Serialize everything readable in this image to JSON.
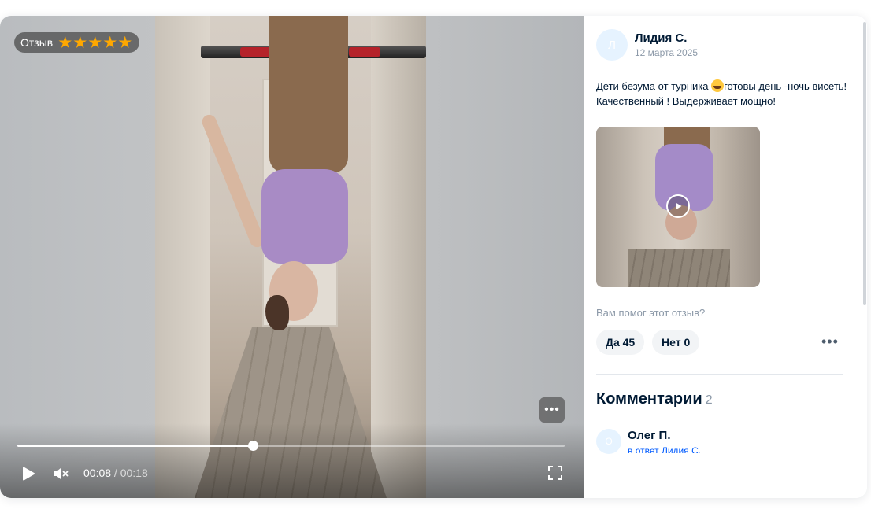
{
  "video": {
    "badge_label": "Отзыв",
    "rating": 5,
    "rating_max": 5,
    "current_time": "00:08",
    "separator": " / ",
    "total_time": "00:18",
    "progress": 0.43,
    "more_label": "•••"
  },
  "review": {
    "author": {
      "initial": "Л",
      "name": "Лидия С.",
      "date": "12 марта 2025"
    },
    "text_part1": "Дети безума от турника ",
    "text_part2": "готовы день -ночь висеть! Качественный ! Выдерживает мощно!",
    "helpful_question": "Вам помог этот отзыв?",
    "yes_label": "Да 45",
    "no_label": "Нет 0",
    "more_label": "•••"
  },
  "comments": {
    "title": "Комментарии",
    "count": "2",
    "items": [
      {
        "initial": "О",
        "name": "Олег П.",
        "reply_to": "в ответ Лидия С."
      }
    ]
  },
  "colors": {
    "accent": "#005bff",
    "star": "#ffa800",
    "text_primary": "#001a34",
    "text_secondary": "#8c99a8"
  },
  "icons": {
    "play": "play-icon",
    "mute": "muted-speaker-icon",
    "fullscreen": "fullscreen-icon",
    "star": "star-icon",
    "thumb_play": "play-circle-icon"
  }
}
